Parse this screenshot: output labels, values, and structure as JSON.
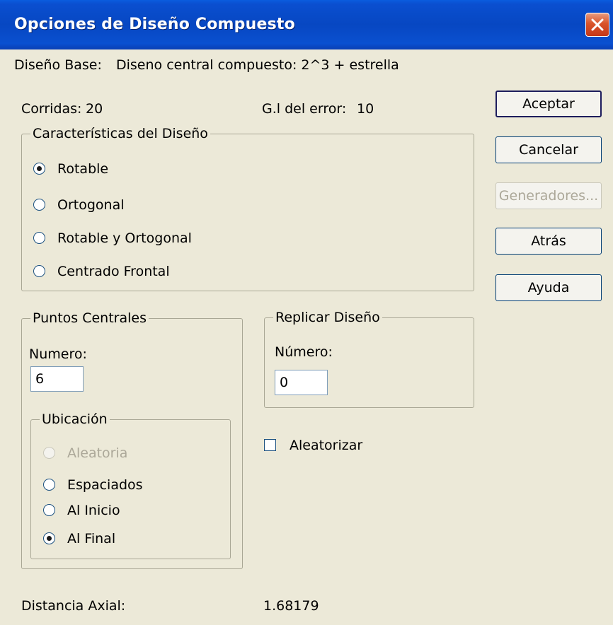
{
  "window": {
    "title": "Opciones de Diseño Compuesto"
  },
  "base_design": {
    "label": "Diseño Base:",
    "value": "Diseno central compuesto: 2^3 + estrella"
  },
  "runs": {
    "label": "Corridas:",
    "value": "20"
  },
  "error_df": {
    "label": "G.l del error:",
    "value": "10"
  },
  "design_characteristics": {
    "legend": "Características del Diseño",
    "options": [
      {
        "label": "Rotable",
        "checked": true
      },
      {
        "label": "Ortogonal",
        "checked": false
      },
      {
        "label": "Rotable y Ortogonal",
        "checked": false
      },
      {
        "label": "Centrado Frontal",
        "checked": false
      }
    ]
  },
  "center_points": {
    "legend": "Puntos Centrales",
    "number_label": "Numero:",
    "number_value": "6",
    "location": {
      "legend": "Ubicación",
      "options": [
        {
          "label": "Aleatoria",
          "checked": false,
          "disabled": true
        },
        {
          "label": "Espaciados",
          "checked": false,
          "disabled": false
        },
        {
          "label": "Al Inicio",
          "checked": false,
          "disabled": false
        },
        {
          "label": "Al Final",
          "checked": true,
          "disabled": false
        }
      ]
    }
  },
  "replicate": {
    "legend": "Replicar Diseño",
    "number_label": "Número:",
    "number_value": "0"
  },
  "randomize": {
    "label": "Aleatorizar",
    "checked": false
  },
  "axial_distance": {
    "label": "Distancia Axial:",
    "value": "1.68179"
  },
  "buttons": {
    "accept": "Aceptar",
    "cancel": "Cancelar",
    "generators": "Generadores...",
    "back": "Atrás",
    "help": "Ayuda"
  }
}
